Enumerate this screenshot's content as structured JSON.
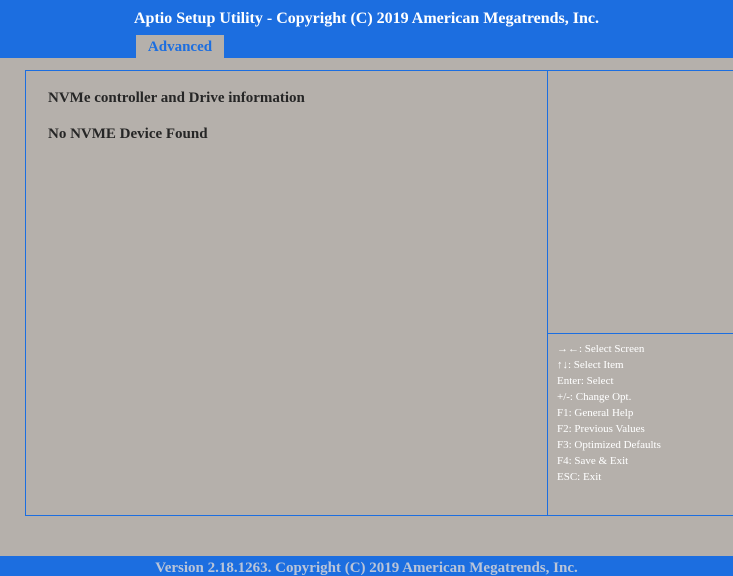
{
  "header": {
    "title": "Aptio Setup Utility - Copyright (C) 2019 American Megatrends, Inc.",
    "tabs": [
      {
        "label": "Advanced",
        "active": true
      }
    ]
  },
  "main": {
    "lines": [
      "NVMe controller and Drive information",
      "No NVME Device Found"
    ]
  },
  "help": {
    "items": [
      "→←: Select Screen",
      "↑↓: Select Item",
      "Enter: Select",
      "+/-: Change Opt.",
      "F1: General Help",
      "F2: Previous Values",
      "F3: Optimized Defaults",
      "F4: Save & Exit",
      "ESC: Exit"
    ]
  },
  "footer": {
    "text": "Version 2.18.1263. Copyright (C) 2019 American Megatrends, Inc."
  },
  "colors": {
    "accent_blue": "#1c6ee0",
    "background": "#b5b0ab",
    "text_dark": "#262626",
    "text_white": "#ffffff"
  }
}
